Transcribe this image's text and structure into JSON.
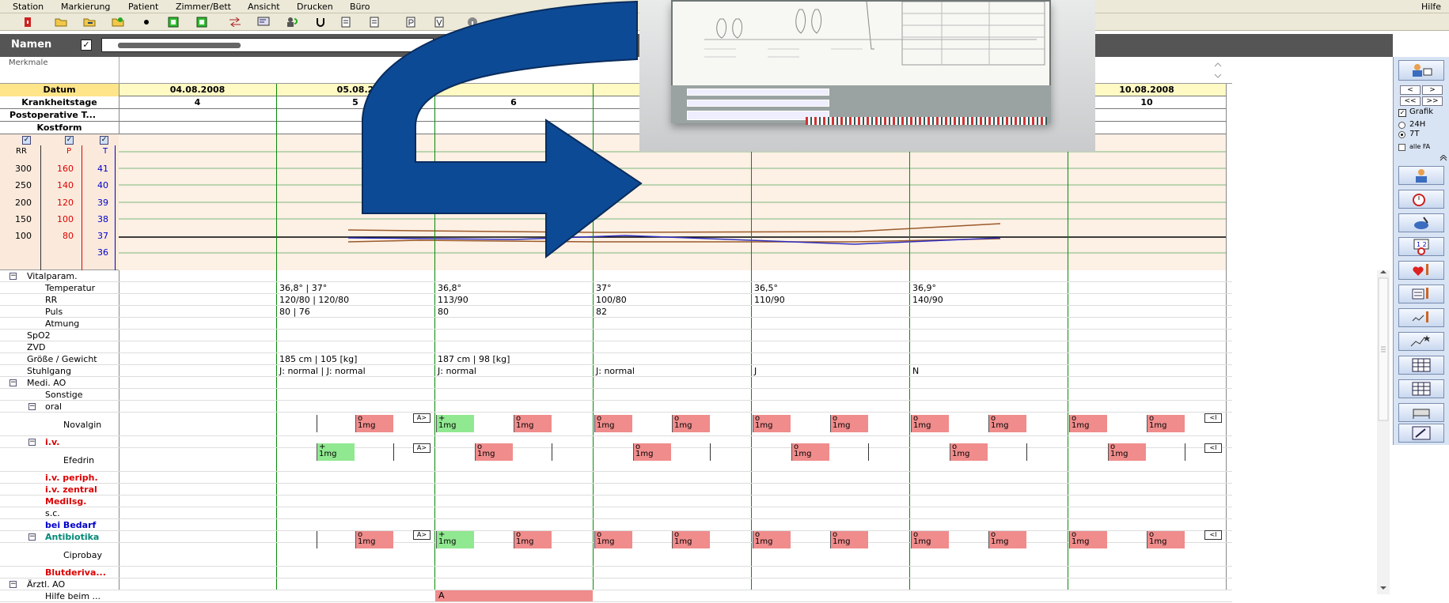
{
  "menu": {
    "items": [
      "Station",
      "Markierung",
      "Patient",
      "Zimmer/Bett",
      "Ansicht",
      "Drucken",
      "Büro"
    ],
    "help": "Hilfe"
  },
  "namebar": {
    "label": "Namen"
  },
  "merkmale": {
    "label": "Merkmale"
  },
  "header": {
    "datum_label": "Datum",
    "krankheitstage_label": "Krankheitstage",
    "postoperative_label": "Postoperative T...",
    "kostform_label": "Kostform",
    "dates": [
      "04.08.2008",
      "05.08.2",
      "",
      "",
      "",
      "",
      "10.08.2008"
    ],
    "days": [
      "4",
      "5",
      "6",
      "",
      "",
      "",
      "10"
    ]
  },
  "scales": {
    "rr_label": "RR",
    "p_label": "P",
    "t_label": "T",
    "rr": [
      "300",
      "250",
      "200",
      "150",
      "100"
    ],
    "p": [
      "160",
      "140",
      "120",
      "100",
      "80"
    ],
    "t": [
      "41",
      "40",
      "39",
      "38",
      "37",
      "36"
    ]
  },
  "tree": {
    "vitalparam": "Vitalparam.",
    "temperatur": "Temperatur",
    "rr": "RR",
    "puls": "Puls",
    "atmung": "Atmung",
    "spo2": "SpO2",
    "zvd": "ZVD",
    "groesse": "Größe / Gewicht",
    "stuhlgang": "Stuhlgang",
    "medi_ao": "Medi. AO",
    "sonstige": "Sonstige",
    "oral": "oral",
    "novalgin": "Novalgin",
    "iv": "i.v.",
    "efedrin": "Efedrin",
    "iv_periph": "i.v. periph.",
    "iv_zentral": "i.v. zentral",
    "medilsg": "Medilsg.",
    "sc": "s.c.",
    "bei_bedarf": "bei Bedarf",
    "antibiotika": "Antibiotika",
    "ciprobay": "Ciprobay",
    "blutderiva": "Blutderiva...",
    "aerztl_ao": "Ärztl. AO",
    "hilfe_beim": "Hilfe beim ..."
  },
  "values": {
    "temperatur": [
      "36,8° | 37°",
      "36,8°",
      "37°",
      "36,5°",
      "36,9°"
    ],
    "rr": [
      "120/80 | 120/80",
      "113/90",
      "100/80",
      "110/90",
      "140/90"
    ],
    "puls": [
      "80 | 76",
      "80",
      "82"
    ],
    "groesse": [
      "185 cm | 105 [kg]",
      "187 cm | 98 [kg]"
    ],
    "stuhlgang": [
      "J: normal | J: normal",
      "J: normal",
      "J: normal",
      "J",
      "N"
    ],
    "hilfe_marker": "A"
  },
  "dose": {
    "unit": "1mg",
    "plus": "+",
    "zero": "o",
    "arrow_right": "A>",
    "arrow_left": "<I"
  },
  "rightpanel": {
    "grafik": "Grafik",
    "h24": "24H",
    "t7": "7T",
    "alle": "alle FA",
    "nav_prev": "<<",
    "nav_next": ">>",
    "single_prev": "<",
    "single_next": ">"
  },
  "colors": {
    "chrome": "#ece9d8",
    "namebar": "#555555",
    "grid_green": "#0a8a0a",
    "dose_red": "#f08c8c",
    "dose_green": "#90e890",
    "chart_bg": "#fdf0e5",
    "arrow_blue": "#0d4a96"
  }
}
